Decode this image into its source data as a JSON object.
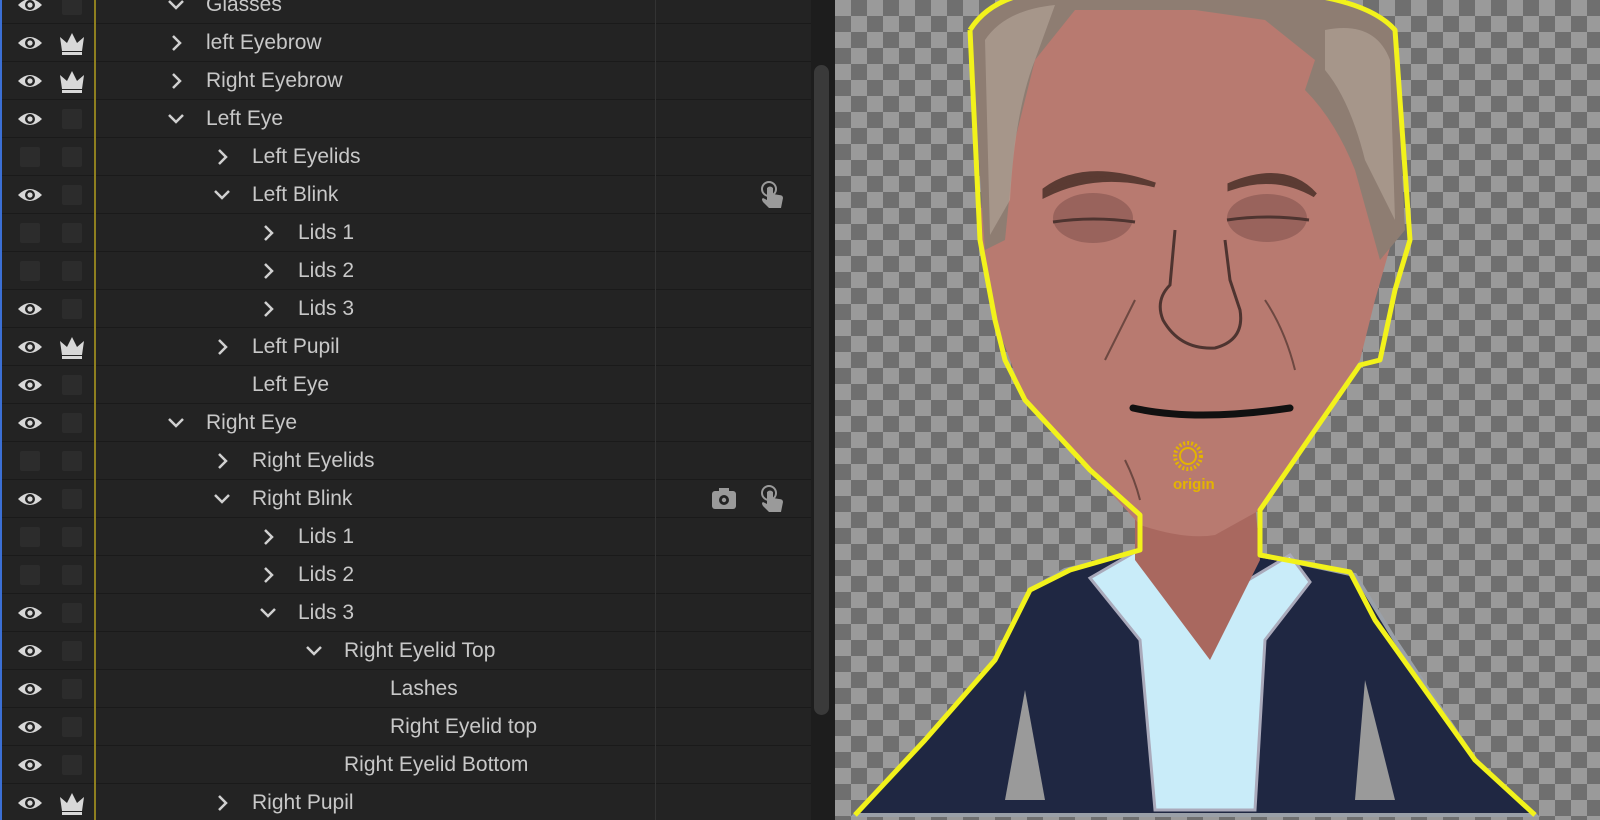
{
  "layers_panel": {
    "rows": [
      {
        "label": "Glasses",
        "depth": 2,
        "expand": "down",
        "visible": true,
        "crown": false
      },
      {
        "label": "left Eyebrow",
        "depth": 2,
        "expand": "right",
        "visible": true,
        "crown": true
      },
      {
        "label": "Right Eyebrow",
        "depth": 2,
        "expand": "right",
        "visible": true,
        "crown": true
      },
      {
        "label": "Left Eye",
        "depth": 2,
        "expand": "down",
        "visible": true,
        "crown": false
      },
      {
        "label": "Left Eyelids",
        "depth": 3,
        "expand": "right",
        "visible": false,
        "crown": false
      },
      {
        "label": "Left Blink",
        "depth": 3,
        "expand": "down",
        "visible": true,
        "crown": false,
        "tools": [
          "hand-trigger-icon"
        ]
      },
      {
        "label": "Lids 1",
        "depth": 4,
        "expand": "right",
        "visible": false,
        "crown": false
      },
      {
        "label": "Lids 2",
        "depth": 4,
        "expand": "right",
        "visible": false,
        "crown": false
      },
      {
        "label": "Lids 3",
        "depth": 4,
        "expand": "right",
        "visible": true,
        "crown": false
      },
      {
        "label": "Left Pupil",
        "depth": 3,
        "expand": "right",
        "visible": true,
        "crown": true
      },
      {
        "label": "Left Eye",
        "depth": 3,
        "expand": "none",
        "visible": true,
        "crown": false
      },
      {
        "label": "Right Eye",
        "depth": 2,
        "expand": "down",
        "visible": true,
        "crown": false
      },
      {
        "label": "Right Eyelids",
        "depth": 3,
        "expand": "right",
        "visible": false,
        "crown": false
      },
      {
        "label": "Right Blink",
        "depth": 3,
        "expand": "down",
        "visible": true,
        "crown": false,
        "tools": [
          "camera-gear-icon",
          "hand-trigger-icon"
        ]
      },
      {
        "label": "Lids 1",
        "depth": 4,
        "expand": "right",
        "visible": false,
        "crown": false
      },
      {
        "label": "Lids 2",
        "depth": 4,
        "expand": "right",
        "visible": false,
        "crown": false
      },
      {
        "label": "Lids 3",
        "depth": 4,
        "expand": "down",
        "visible": true,
        "crown": false
      },
      {
        "label": "Right Eyelid Top",
        "depth": 5,
        "expand": "down",
        "visible": true,
        "crown": false
      },
      {
        "label": "Lashes",
        "depth": 6,
        "expand": "none",
        "visible": true,
        "crown": false
      },
      {
        "label": "Right Eyelid top",
        "depth": 6,
        "expand": "none",
        "visible": true,
        "crown": false
      },
      {
        "label": "Right Eyelid Bottom",
        "depth": 5,
        "expand": "none",
        "visible": true,
        "crown": false
      },
      {
        "label": "Right Pupil",
        "depth": 3,
        "expand": "right",
        "visible": true,
        "crown": true
      }
    ]
  },
  "canvas": {
    "origin_label": "origin"
  },
  "colors": {
    "selection_outline": "#f2f21b",
    "origin_marker": "#e3b400",
    "skin": "#b87a70",
    "jacket": "#1f2742",
    "shirt": "#c9ecf9"
  }
}
